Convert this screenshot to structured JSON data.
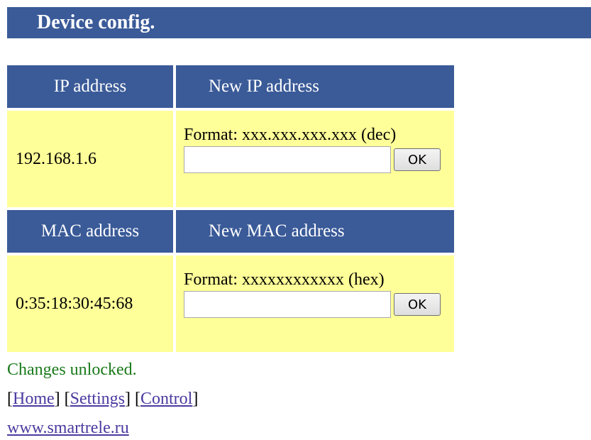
{
  "page": {
    "title": "Device config."
  },
  "ip": {
    "header_current": "IP address",
    "header_new": "New IP address",
    "current_value": "192.168.1.6",
    "format_text": "Format: xxx.xxx.xxx.xxx (dec)",
    "input_value": "",
    "ok_label": "OK"
  },
  "mac": {
    "header_current": "MAC address",
    "header_new": "New MAC address",
    "current_value": "0:35:18:30:45:68",
    "format_text": "Format: xxxxxxxxxxxx (hex)",
    "input_value": "",
    "ok_label": "OK"
  },
  "status": {
    "text": "Changes unlocked.",
    "color": "#1a7a1a"
  },
  "nav": {
    "home": "Home",
    "settings": "Settings",
    "control": "Control"
  },
  "footer": {
    "site_link": "www.smartrele.ru"
  },
  "colors": {
    "header_bg": "#3a5a98",
    "cell_bg": "#ffff99",
    "link": "#4a3aa0"
  }
}
